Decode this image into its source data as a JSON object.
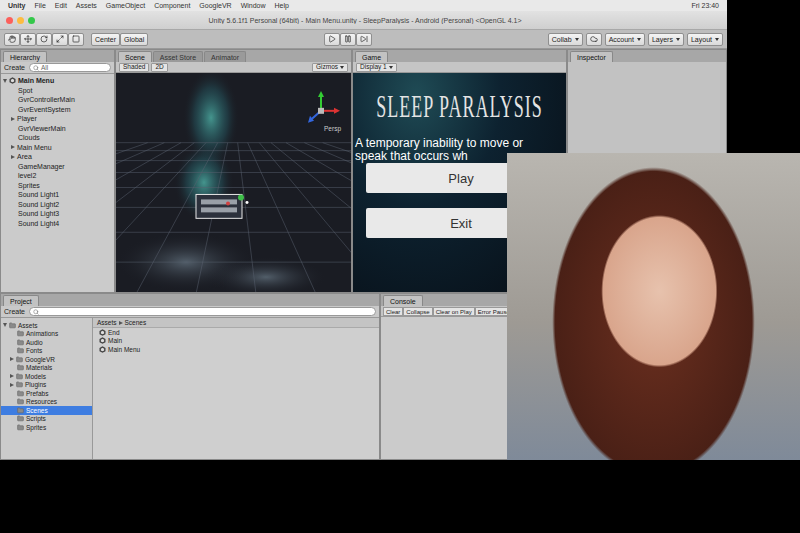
{
  "menubar": {
    "items": [
      "Unity",
      "File",
      "Edit",
      "Assets",
      "GameObject",
      "Component",
      "GoogleVR",
      "Window",
      "Help"
    ],
    "clock": "Fri 23:40"
  },
  "window": {
    "title": "Unity 5.6.1f1 Personal (64bit) - Main Menu.unity - SleepParalysis - Android (Personal) <OpenGL 4.1>"
  },
  "toolbar": {
    "pivot": [
      "Center",
      "Global"
    ],
    "dropdowns": [
      "Collab",
      "Account",
      "Layers",
      "Layout"
    ]
  },
  "hierarchy": {
    "tab": {
      "label": "Hierarchy",
      "selected": true
    },
    "create": "Create",
    "search": "All",
    "items": [
      {
        "label": "Main Menu",
        "kind": "scene",
        "expandable": true,
        "expanded": true
      },
      {
        "label": "Spot",
        "kind": "object",
        "expandable": false,
        "expanded": false
      },
      {
        "label": "GvrControllerMain",
        "kind": "object",
        "expandable": false,
        "expanded": false
      },
      {
        "label": "GvrEventSystem",
        "kind": "object",
        "expandable": false,
        "expanded": false
      },
      {
        "label": "Player",
        "kind": "object",
        "expandable": true,
        "expanded": false
      },
      {
        "label": "GvrViewerMain",
        "kind": "object",
        "expandable": false,
        "expanded": false
      },
      {
        "label": "Clouds",
        "kind": "object",
        "expandable": false,
        "expanded": false
      },
      {
        "label": "Main Menu",
        "kind": "object",
        "expandable": true,
        "expanded": false
      },
      {
        "label": "Area",
        "kind": "object",
        "expandable": true,
        "expanded": false
      },
      {
        "label": "GameManager",
        "kind": "object",
        "expandable": false,
        "expanded": false
      },
      {
        "label": "level2",
        "kind": "object",
        "expandable": false,
        "expanded": false
      },
      {
        "label": "Sprites",
        "kind": "object",
        "expandable": false,
        "expanded": false
      },
      {
        "label": "Sound Light1",
        "kind": "object",
        "expandable": false,
        "expanded": false
      },
      {
        "label": "Sound Light2",
        "kind": "object",
        "expandable": false,
        "expanded": false
      },
      {
        "label": "Sound Light3",
        "kind": "object",
        "expandable": false,
        "expanded": false
      },
      {
        "label": "Sound Light4",
        "kind": "object",
        "expandable": false,
        "expanded": false
      }
    ]
  },
  "scene": {
    "tabs": [
      {
        "label": "Scene",
        "selected": true
      },
      {
        "label": "Asset Store",
        "selected": false
      },
      {
        "label": "Animator",
        "selected": false
      }
    ],
    "controls": [
      "Shaded",
      "2D"
    ],
    "gizmos": "Gizmos",
    "view_label": "Persp"
  },
  "game": {
    "tabs": [
      {
        "label": "Game",
        "selected": true
      }
    ],
    "display": "Display 1",
    "title": "SLEEP PARALYSIS",
    "subtitle": [
      "A temporary inability to move or",
      "speak that occurs wh"
    ],
    "buttons": [
      "Play",
      "Exit"
    ]
  },
  "inspector": {
    "tab": {
      "label": "Inspector",
      "selected": true
    }
  },
  "project": {
    "tab": {
      "label": "Project",
      "selected": true
    },
    "create": "Create",
    "breadcrumb": [
      "Assets",
      "Scenes"
    ],
    "folders": [
      {
        "label": "Assets",
        "kind": "root",
        "expandable": true,
        "expanded": true,
        "selected": false
      },
      {
        "label": "Animations",
        "kind": "child",
        "expandable": false,
        "expanded": false,
        "selected": false
      },
      {
        "label": "Audio",
        "kind": "child",
        "expandable": false,
        "expanded": false,
        "selected": false
      },
      {
        "label": "Fonts",
        "kind": "child",
        "expandable": false,
        "expanded": false,
        "selected": false
      },
      {
        "label": "GoogleVR",
        "kind": "child",
        "expandable": true,
        "expanded": false,
        "selected": false
      },
      {
        "label": "Materials",
        "kind": "child",
        "expandable": false,
        "expanded": false,
        "selected": false
      },
      {
        "label": "Models",
        "kind": "child",
        "expandable": true,
        "expanded": false,
        "selected": false
      },
      {
        "label": "Plugins",
        "kind": "child",
        "expandable": true,
        "expanded": false,
        "selected": false
      },
      {
        "label": "Prefabs",
        "kind": "child",
        "expandable": false,
        "expanded": false,
        "selected": false
      },
      {
        "label": "Resources",
        "kind": "child",
        "expandable": false,
        "expanded": false,
        "selected": false
      },
      {
        "label": "Scenes",
        "kind": "child",
        "expandable": false,
        "expanded": false,
        "selected": true
      },
      {
        "label": "Scripts",
        "kind": "child",
        "expandable": false,
        "expanded": false,
        "selected": false
      },
      {
        "label": "Sprites",
        "kind": "child",
        "expandable": false,
        "expanded": false,
        "selected": false
      }
    ],
    "files": [
      "End",
      "Main",
      "Main Menu"
    ]
  },
  "console": {
    "tab": {
      "label": "Console",
      "selected": true
    },
    "buttons": [
      "Clear",
      "Collapse",
      "Clear on Play",
      "Error Pause"
    ]
  }
}
